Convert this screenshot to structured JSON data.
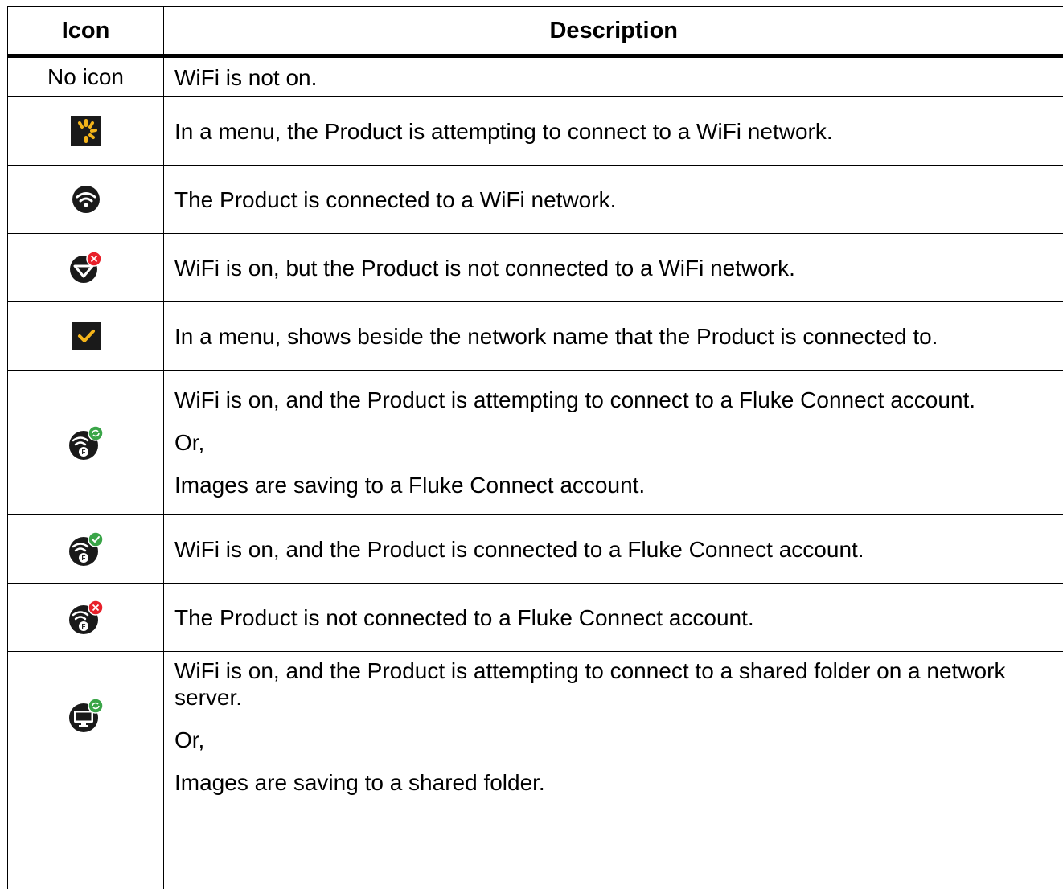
{
  "table": {
    "headers": {
      "icon": "Icon",
      "description": "Description"
    },
    "rows": [
      {
        "icon": "none",
        "icon_text": "No icon",
        "description": [
          "WiFi is not on."
        ]
      },
      {
        "icon": "connecting-spinner-icon",
        "description": [
          "In a menu, the Product is attempting to connect to a WiFi network."
        ]
      },
      {
        "icon": "wifi-connected-icon",
        "description": [
          "The Product is connected to a WiFi network."
        ]
      },
      {
        "icon": "wifi-not-connected-icon",
        "description": [
          "WiFi is on, but the Product is not connected to a WiFi network."
        ]
      },
      {
        "icon": "yellow-checkmark-icon",
        "description": [
          "In a menu, shows beside the network name that the Product is connected to."
        ]
      },
      {
        "icon": "fluke-connect-syncing-icon",
        "description": [
          "WiFi is on, and the Product is attempting to connect to a Fluke Connect account.",
          "Or,",
          "Images are saving to a Fluke Connect account."
        ]
      },
      {
        "icon": "fluke-connect-connected-icon",
        "description": [
          "WiFi is on, and the Product is connected to a Fluke Connect account."
        ]
      },
      {
        "icon": "fluke-connect-not-connected-icon",
        "description": [
          "The Product is not connected to a Fluke Connect account."
        ]
      },
      {
        "icon": "shared-folder-syncing-icon",
        "description": [
          "WiFi is on, and the Product is attempting to connect to a shared folder on a network server.",
          "Or,",
          "Images are saving to a shared folder."
        ]
      }
    ]
  },
  "colors": {
    "spinner_yellow": "#f4b41a",
    "status_red": "#e8202a",
    "status_green": "#3aa548",
    "icon_dark": "#1a1a1a"
  }
}
